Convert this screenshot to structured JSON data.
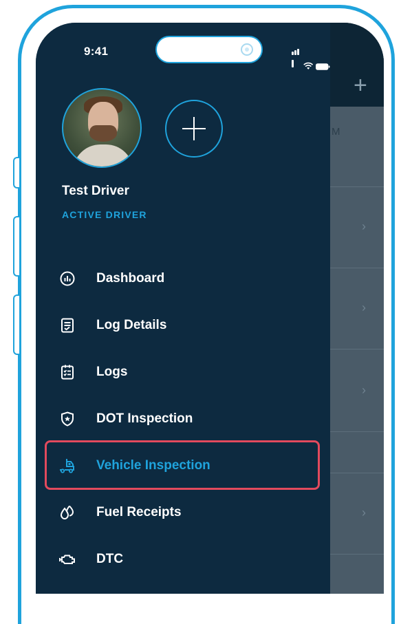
{
  "status_bar": {
    "time": "9:41"
  },
  "profile": {
    "name": "Test Driver",
    "role": "ACTIVE DRIVER"
  },
  "background_page": {
    "partial_text": "M"
  },
  "menu": {
    "items": [
      {
        "label": "Dashboard",
        "icon": "dashboard-icon"
      },
      {
        "label": "Log Details",
        "icon": "log-details-icon"
      },
      {
        "label": "Logs",
        "icon": "logs-icon"
      },
      {
        "label": "DOT Inspection",
        "icon": "shield-badge-icon"
      },
      {
        "label": "Vehicle Inspection",
        "icon": "vehicle-icon",
        "active": true
      },
      {
        "label": "Fuel Receipts",
        "icon": "fuel-drops-icon"
      },
      {
        "label": "DTC",
        "icon": "engine-icon"
      }
    ]
  },
  "colors": {
    "drawer_bg": "#0d2a40",
    "accent": "#1fa3dc",
    "highlight_border": "#e24a5d",
    "text": "#ffffff"
  }
}
